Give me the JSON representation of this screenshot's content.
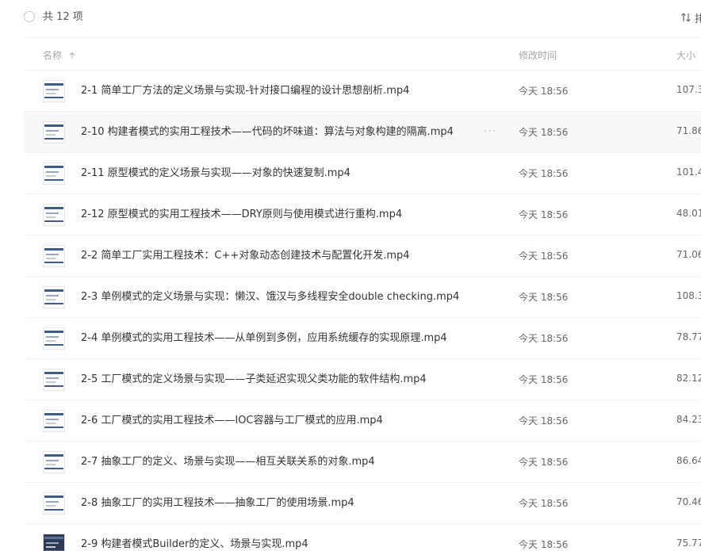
{
  "toolbar": {
    "count_label": "共 12 项",
    "sort_label": "排序"
  },
  "columns": {
    "name": "名称",
    "modified": "修改时间",
    "size": "大小"
  },
  "files": [
    {
      "name": "2-1 简单工厂方法的定义场景与实现-针对接口编程的设计思想剖析.mp4",
      "modified": "今天 18:56",
      "size": "107.3"
    },
    {
      "name": "2-10 构建者模式的实用工程技术——代码的坏味道：算法与对象构建的隔离.mp4",
      "modified": "今天 18:56",
      "size": "71.86"
    },
    {
      "name": "2-11 原型模式的定义场景与实现——对象的快速复制.mp4",
      "modified": "今天 18:56",
      "size": "101.4"
    },
    {
      "name": "2-12 原型模式的实用工程技术——DRY原则与使用模式进行重构.mp4",
      "modified": "今天 18:56",
      "size": "48.01"
    },
    {
      "name": "2-2 简单工厂实用工程技术：C++对象动态创建技术与配置化开发.mp4",
      "modified": "今天 18:56",
      "size": "71.06"
    },
    {
      "name": "2-3 单例模式的定义场景与实现：懒汉、饿汉与多线程安全double checking.mp4",
      "modified": "今天 18:56",
      "size": "108.3"
    },
    {
      "name": "2-4 单例模式的实用工程技术——从单例到多例，应用系统缓存的实现原理.mp4",
      "modified": "今天 18:56",
      "size": "78.77"
    },
    {
      "name": "2-5 工厂模式的定义场景与实现——子类延迟实现父类功能的软件结构.mp4",
      "modified": "今天 18:56",
      "size": "82.12"
    },
    {
      "name": "2-6 工厂模式的实用工程技术——IOC容器与工厂模式的应用.mp4",
      "modified": "今天 18:56",
      "size": "84.23"
    },
    {
      "name": "2-7 抽象工厂的定义、场景与实现——相互关联关系的对象.mp4",
      "modified": "今天 18:56",
      "size": "86.64"
    },
    {
      "name": "2-8 抽象工厂的实用工程技术——抽象工厂的使用场景.mp4",
      "modified": "今天 18:56",
      "size": "70.46"
    },
    {
      "name": "2-9 构建者模式Builder的定义、场景与实现.mp4",
      "modified": "今天 18:56",
      "size": "75.77"
    }
  ],
  "row_more_label": "···",
  "icons": {
    "select_all": "circle-checkbox-icon",
    "sort": "sort-arrows-icon",
    "sort_direction": "arrow-up-icon",
    "file_thumb": "video-thumbnail-icon"
  },
  "colors": {
    "hover_row": "#f7f8fa",
    "thumb_accent": "#3a5a94"
  }
}
